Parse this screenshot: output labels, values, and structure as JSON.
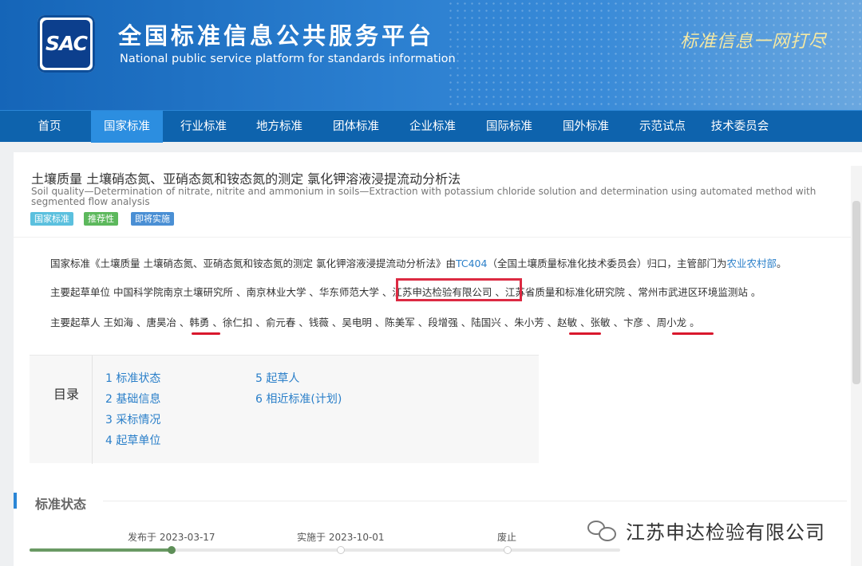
{
  "header": {
    "logo_text": "SAC",
    "title": "全国标准信息公共服务平台",
    "subtitle": "National public service platform  for standards information",
    "slogan": "标准信息一网打尽"
  },
  "nav": [
    "首页",
    "国家标准",
    "行业标准",
    "地方标准",
    "团体标准",
    "企业标准",
    "国际标准",
    "国外标准",
    "示范试点",
    "技术委员会"
  ],
  "nav_active": "国家标准",
  "standard": {
    "title_cn": "土壤质量 土壤硝态氮、亚硝态氮和铵态氮的测定 氯化钾溶液浸提流动分析法",
    "title_en": "Soil quality—Determination of nitrate, nitrite and ammonium in soils—Extraction with potassium chloride solution and determination using automated method with segmented flow analysis",
    "badges": [
      {
        "label": "国家标准",
        "color": "#5bc0de"
      },
      {
        "label": "推荐性",
        "color": "#5cb85c"
      },
      {
        "label": "即将实施",
        "color": "#4a8fd4"
      }
    ]
  },
  "summary": {
    "line1_pre": "国家标准《土壤质量 土壤硝态氮、亚硝态氮和铵态氮的测定 氯化钾溶液浸提流动分析法》由",
    "line1_tc": "TC404",
    "line1_mid": "（全国土壤质量标准化技术委员会）归口，主管部门为",
    "line1_dept": "农业农村部",
    "line1_end": "。",
    "line2_a": "主要起草单位 中国科学院南京土壤研究所 、南京林业大学 、华东师范大学 、",
    "line2_hl": "江苏申达检验有限公司",
    "line2_b": " 、江苏省质量和标准化研究院 、常州市武进区环境监测站 。",
    "line3": "主要起草人 王如海 、唐昊冶 、韩勇 、徐仁扣 、俞元春 、钱薇 、吴电明 、陈美军 、段增强 、陆国兴 、朱小芳 、赵敏 、张敏 、卞彦 、周小龙 。"
  },
  "toc": {
    "label": "目录",
    "items": [
      "1 标准状态",
      "2 基础信息",
      "3 采标情况",
      "4 起草单位",
      "5 起草人",
      "6 相近标准(计划)"
    ]
  },
  "status": {
    "section_title": "标准状态",
    "milestones": [
      {
        "label": "发布于 2023-03-17",
        "done": true
      },
      {
        "label": "实施于 2023-10-01",
        "done": false
      },
      {
        "label": "废止",
        "done": false
      }
    ]
  },
  "watermark": "江苏申达检验有限公司"
}
